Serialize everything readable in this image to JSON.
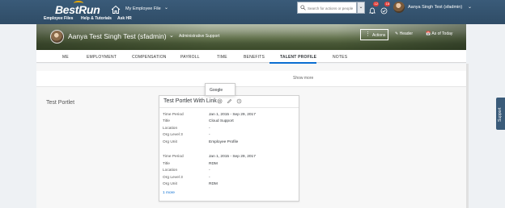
{
  "shell": {
    "logo": "BestRun",
    "employee_file_menu": "My Employee File",
    "search_placeholder": "Search for actions or people",
    "notification_count": "12",
    "notification_count_2": "18",
    "user_name": "Aanya Singh Test (sfadmin)"
  },
  "linkbar": {
    "items": [
      "Employee Files",
      "Help & Tutorials",
      "Ask HR"
    ]
  },
  "header": {
    "name": "Aanya Test Singh Test (sfadmin)",
    "subtitle": "Administrative Support",
    "actions_label": "Actions",
    "header_label": "Header",
    "as_of_label": "As of Today"
  },
  "tabs": [
    "ME",
    "EMPLOYMENT",
    "COMPENSATION",
    "PAYROLL",
    "TIME",
    "BENEFITS",
    "TALENT PROFILE",
    "NOTES"
  ],
  "active_tab": "TALENT PROFILE",
  "content": {
    "show_more": "Show more",
    "portlet_left_title": "Test Portlet",
    "card_title": "Test Portlet With Link",
    "tooltip_text": "Google",
    "blocks": [
      {
        "rows": [
          {
            "label": "Time Period",
            "value": "Jan 1, 2015 - Sep 29, 2017"
          },
          {
            "label": "Title",
            "value": "Cloud Support"
          },
          {
            "label": "Location",
            "value": "-"
          },
          {
            "label": "Org Level 3",
            "value": "-"
          },
          {
            "label": "Org Unit",
            "value": "Employee Profile"
          }
        ]
      },
      {
        "rows": [
          {
            "label": "Time Period",
            "value": "Jan 1, 2015 - Sep 29, 2017"
          },
          {
            "label": "Title",
            "value": "RDM"
          },
          {
            "label": "Location",
            "value": "-"
          },
          {
            "label": "Org Level 3",
            "value": "-"
          },
          {
            "label": "Org Unit",
            "value": "RDM"
          }
        ]
      }
    ],
    "more_link": "1 more"
  },
  "support_label": "Support",
  "colors": {
    "shell": "#35536f",
    "accent": "#0a6ed1",
    "badge": "#e0403b"
  }
}
